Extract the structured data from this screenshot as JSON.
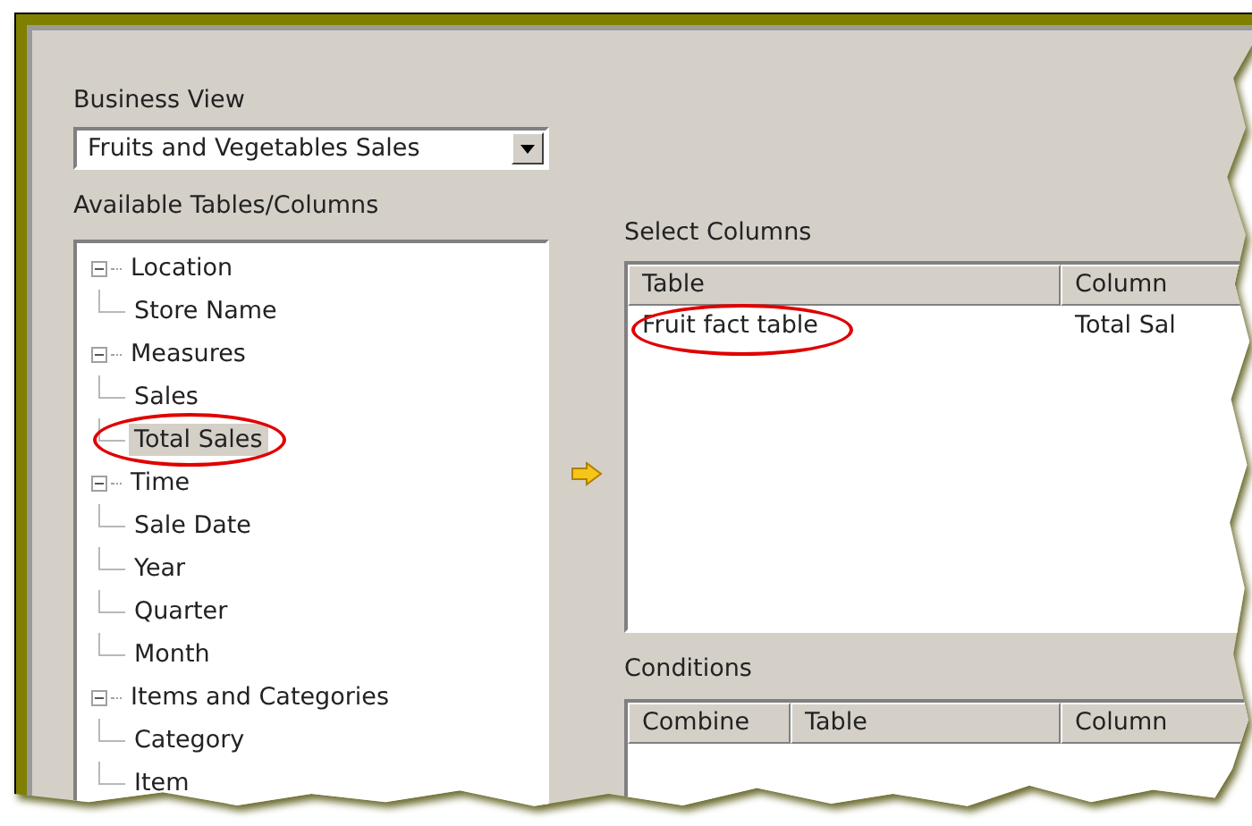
{
  "business_view": {
    "label": "Business View",
    "value": "Fruits and Vegetables Sales"
  },
  "available": {
    "label": "Available Tables/Columns",
    "tree": [
      {
        "label": "Location",
        "expanded": true,
        "selected": false,
        "children": [
          {
            "label": "Store Name",
            "selected": false,
            "circled": false
          }
        ]
      },
      {
        "label": "Measures",
        "expanded": true,
        "selected": false,
        "children": [
          {
            "label": "Sales",
            "selected": false,
            "circled": false
          },
          {
            "label": "Total Sales",
            "selected": true,
            "circled": true
          }
        ]
      },
      {
        "label": "Time",
        "expanded": true,
        "selected": false,
        "children": [
          {
            "label": "Sale Date",
            "selected": false,
            "circled": false
          },
          {
            "label": "Year",
            "selected": false,
            "circled": false
          },
          {
            "label": "Quarter",
            "selected": false,
            "circled": false
          },
          {
            "label": "Month",
            "selected": false,
            "circled": false
          }
        ]
      },
      {
        "label": "Items and Categories",
        "expanded": true,
        "selected": false,
        "children": [
          {
            "label": "Category",
            "selected": false,
            "circled": false
          },
          {
            "label": "Item",
            "selected": false,
            "circled": false
          }
        ]
      }
    ]
  },
  "select_columns": {
    "label": "Select Columns",
    "columns": [
      "Table",
      "Column"
    ],
    "rows": [
      {
        "cells": [
          "Fruit fact table",
          "Total Sal"
        ],
        "circled": true
      }
    ]
  },
  "conditions": {
    "label": "Conditions",
    "columns": [
      "Combine",
      "Table",
      "Column"
    ]
  }
}
